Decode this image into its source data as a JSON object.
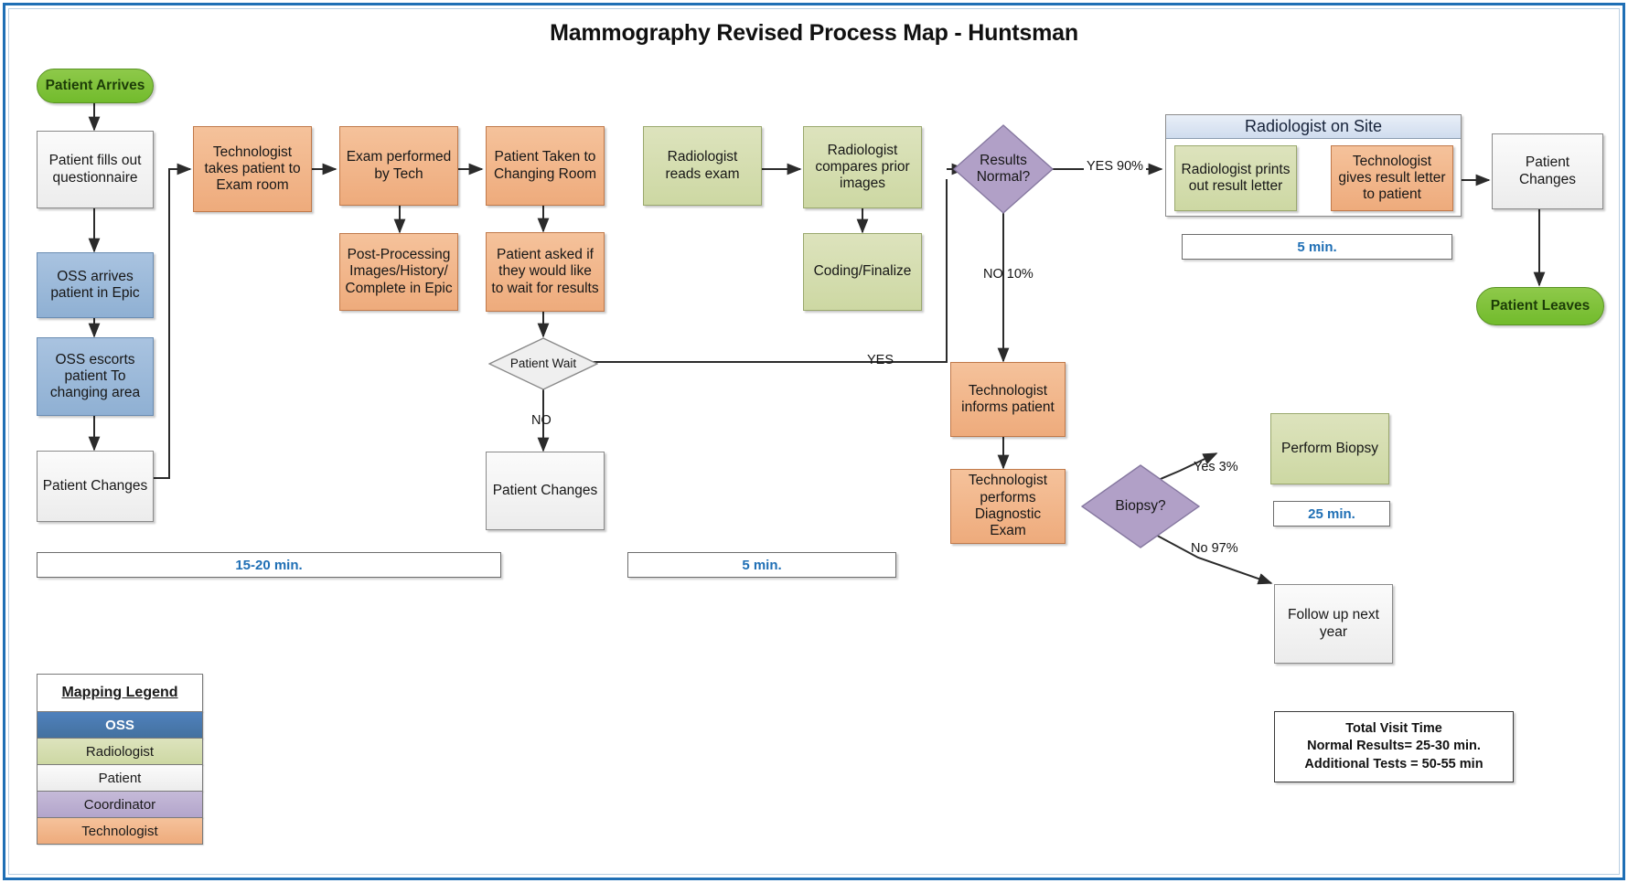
{
  "title": "Mammography Revised Process Map - Huntsman",
  "nodes": {
    "patient_arrives": "Patient Arrives",
    "patient_questionnaire": "Patient fills out questionnaire",
    "oss_arrives": "OSS arrives patient in Epic",
    "oss_escorts": "OSS escorts patient To changing area",
    "patient_changes_1": "Patient Changes",
    "tech_takes": "Technologist takes patient to Exam room",
    "exam_performed": "Exam performed by  Tech",
    "post_processing": "Post-Processing Images/History/ Complete in Epic",
    "patient_taken_changing": "Patient Taken to Changing Room",
    "patient_asked_wait": "Patient asked if they would like to wait for results",
    "patient_wait_decision": "Patient Wait",
    "patient_changes_2": "Patient Changes",
    "radiologist_reads": "Radiologist reads exam",
    "radiologist_compares": "Radiologist compares prior images",
    "coding_finalize": "Coding/Finalize",
    "results_normal": "Results Normal?",
    "rad_onsite_title": "Radiologist on Site",
    "rad_prints_letter": "Radiologist prints out result letter",
    "tech_gives_letter": "Technologist gives result letter to patient",
    "patient_changes_3": "Patient Changes",
    "patient_leaves": "Patient Leaves",
    "tech_informs": "Technologist informs patient",
    "tech_diagnostic": "Technologist performs Diagnostic Exam",
    "biopsy_decision": "Biopsy?",
    "perform_biopsy": "Perform Biopsy",
    "follow_up": "Follow up next year"
  },
  "edge_labels": {
    "patient_wait_yes": "YES",
    "patient_wait_no": "NO",
    "results_yes": "YES 90%",
    "results_no": "NO 10%",
    "biopsy_yes": "Yes 3%",
    "biopsy_no": "No 97%"
  },
  "time_bars": {
    "intake": "15-20 min.",
    "exam": "5 min.",
    "result_letter": "5 min.",
    "biopsy": "25 min."
  },
  "legend": {
    "title": "Mapping Legend",
    "items": [
      {
        "label": "OSS",
        "color": "#4f81bd"
      },
      {
        "label": "Radiologist",
        "color": "#d2dbac"
      },
      {
        "label": "Patient",
        "color": "#efefef"
      },
      {
        "label": "Coordinator",
        "color": "#b9acd0"
      },
      {
        "label": "Technologist",
        "color": "#f0b183"
      }
    ]
  },
  "total_visit": {
    "line1": "Total Visit Time",
    "line2": "Normal Results= 25-30 min.",
    "line3": "Additional Tests = 50-55 min"
  },
  "colors": {
    "frame": "#1F6FB5",
    "oss": "#95b3d7",
    "radiologist": "#d2dbac",
    "patient": "#efefef",
    "coordinator": "#b1a0c7",
    "technologist": "#f0b183",
    "terminator": "#7ec043",
    "time_text": "#1F6FB5"
  }
}
